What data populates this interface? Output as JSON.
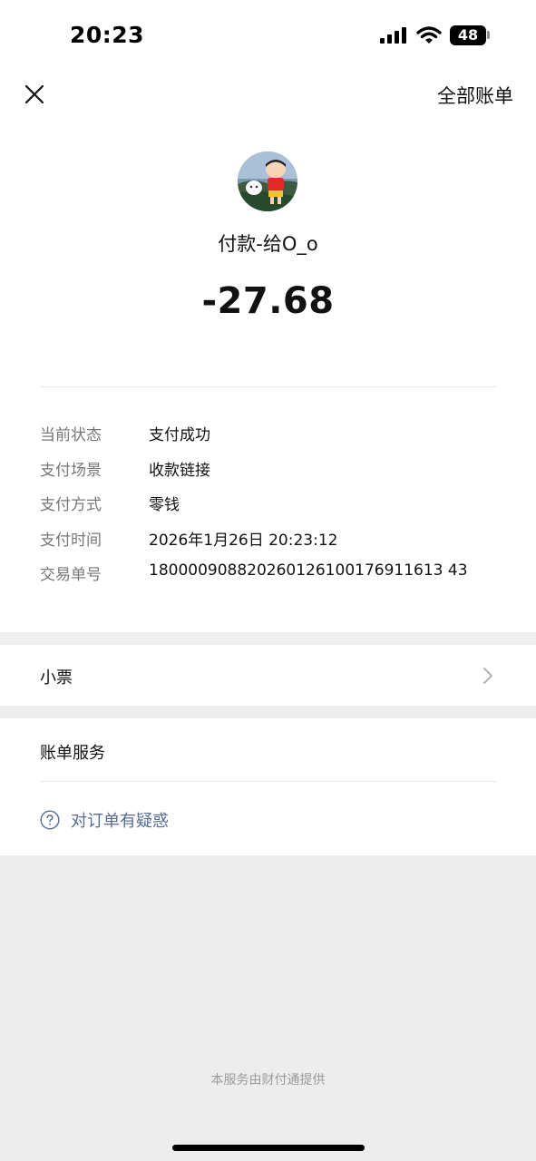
{
  "status_bar": {
    "time": "20:23",
    "battery_level": "48",
    "icons": [
      "signal-icon",
      "wifi-icon",
      "battery-icon"
    ]
  },
  "nav": {
    "close_icon": "close-icon",
    "all_bills_label": "全部账单"
  },
  "header": {
    "payee": "付款-给O_o",
    "amount": "-27.68"
  },
  "details": [
    {
      "label": "当前状态",
      "value": "支付成功"
    },
    {
      "label": "支付场景",
      "value": "收款链接"
    },
    {
      "label": "支付方式",
      "value": "零钱"
    },
    {
      "label": "支付时间",
      "value": "2026年1月26日 20:23:12"
    },
    {
      "label": "交易单号",
      "value": "180000908820260126100176911613 43"
    }
  ],
  "receipt": {
    "label": "小票",
    "chevron_icon": "chevron-right-icon"
  },
  "bill_service": {
    "title": "账单服务",
    "help_icon": "question-circle-icon",
    "help_link": "对订单有疑惑"
  },
  "footer": {
    "note": "本服务由财付通提供"
  },
  "colors": {
    "background": "#ededed",
    "card": "#ffffff",
    "link": "#576b95",
    "label": "#777777"
  }
}
